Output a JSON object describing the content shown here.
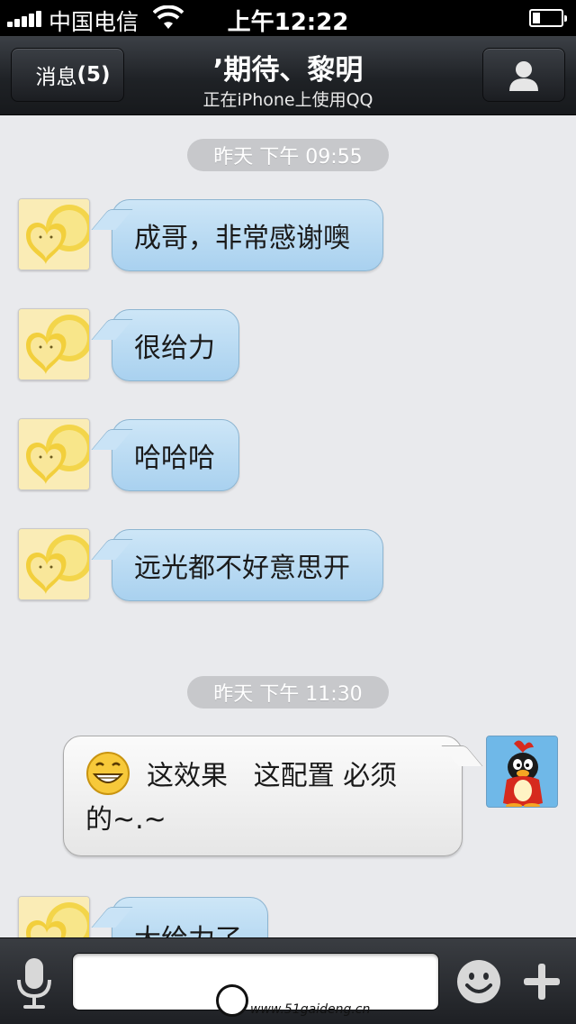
{
  "status_bar": {
    "carrier": "中国电信",
    "time": "上午12:22"
  },
  "nav": {
    "back_label": "消息",
    "back_count": "(5)",
    "title": "’期待、黎明",
    "subtitle": "正在iPhone上使用QQ",
    "profile_icon": "person-icon"
  },
  "chat": {
    "timestamps": [
      "昨天 下午 09:55",
      "昨天 下午 11:30"
    ],
    "incoming": [
      "成哥，非常感谢噢",
      "很给力",
      "哈哈哈",
      "远光都不好意思开",
      "大给力了"
    ],
    "outgoing": {
      "line1": "这效果   这配置 必须",
      "line2": "的~.~",
      "emoji": "grin-emoji"
    }
  },
  "input_bar": {
    "mic_icon": "microphone-icon",
    "text_value": "",
    "emoji_icon": "smiley-icon",
    "plus_icon": "plus-icon"
  },
  "watermark": {
    "text": "www.51gaideng.cn"
  },
  "colors": {
    "incoming_bubble": "#b9dbf3",
    "outgoing_bubble": "#f2f2f2",
    "nav_bg": "#23262a",
    "chat_bg": "#e9eaed",
    "timestamp_bg": "#c7c8cb"
  }
}
